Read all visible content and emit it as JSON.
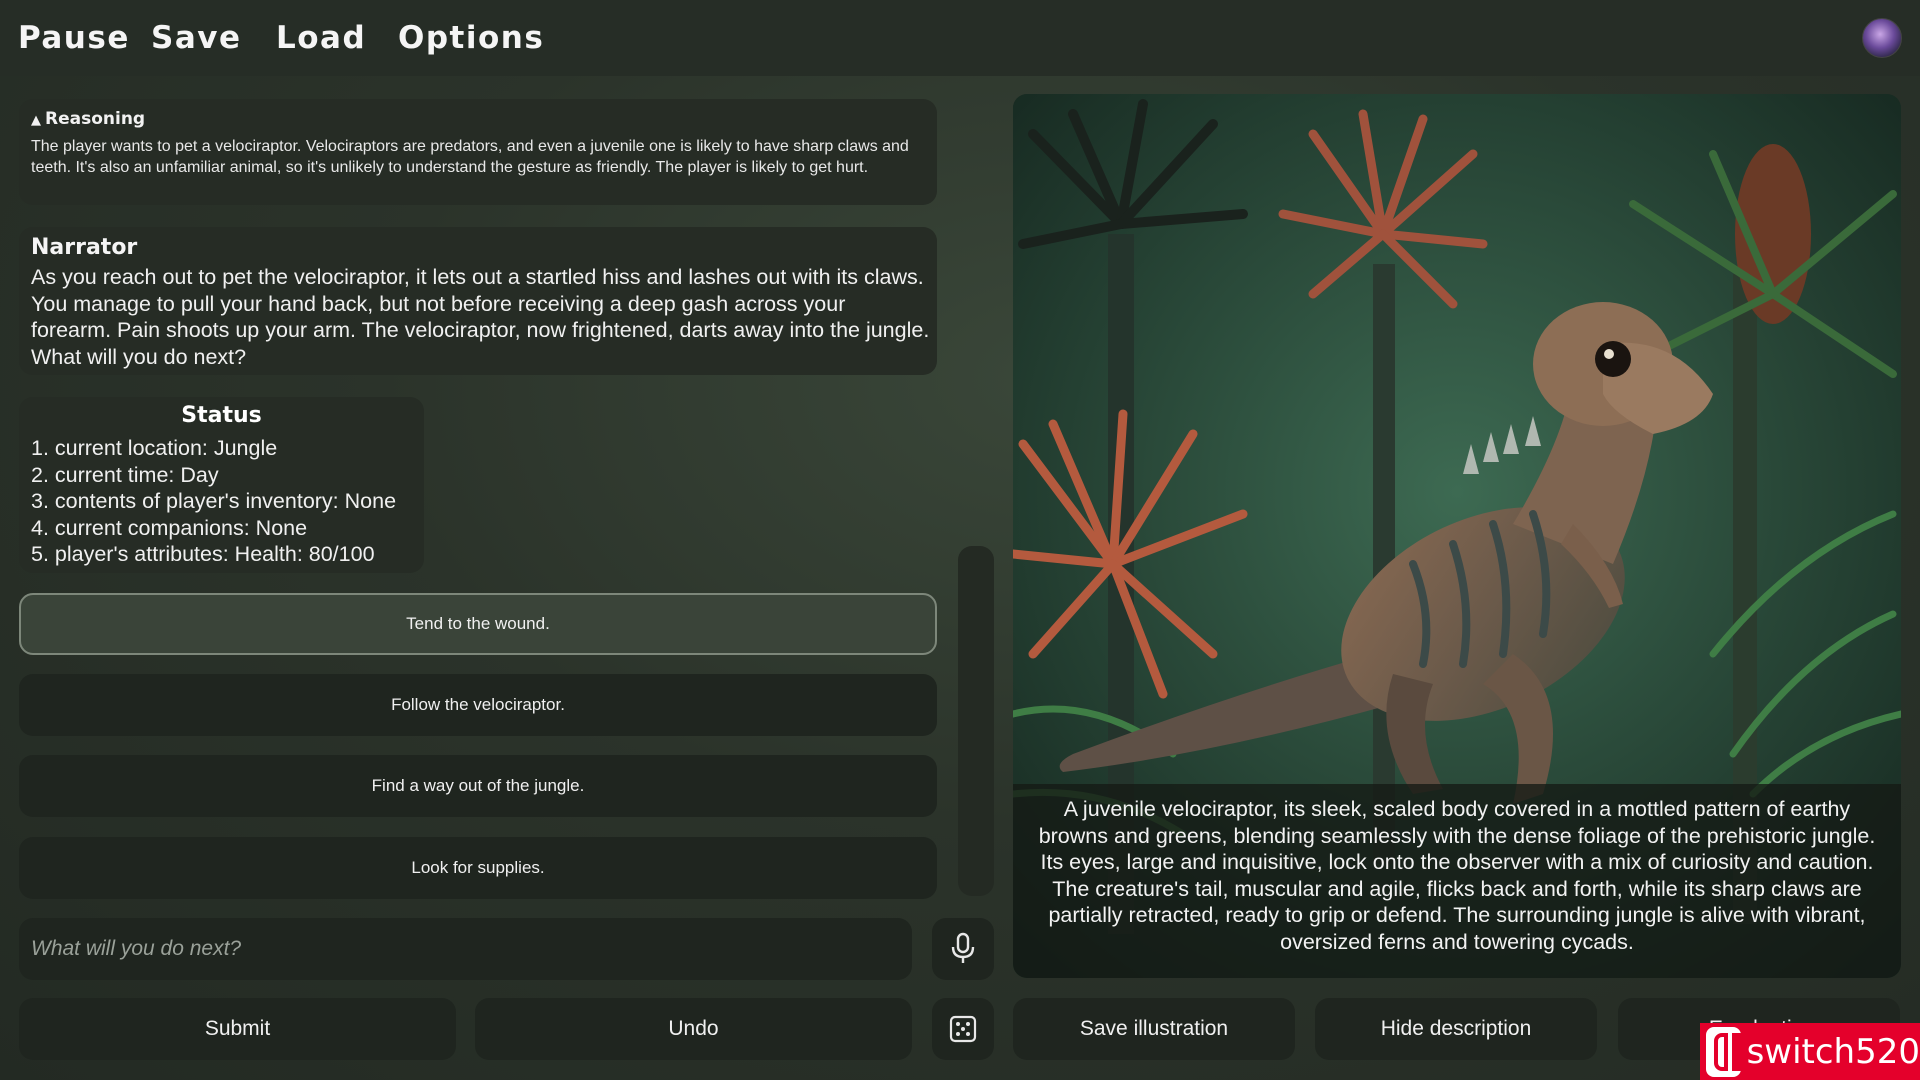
{
  "menu": {
    "pause": "Pause",
    "save": "Save",
    "load": "Load",
    "options": "Options"
  },
  "reasoning": {
    "title": "Reasoning",
    "text": "The player wants to pet a velociraptor. Velociraptors are predators, and even a juvenile one is likely to have sharp claws and teeth. It's also an unfamiliar animal, so it's unlikely to understand the gesture as friendly. The player is likely to get hurt."
  },
  "narrator": {
    "title": "Narrator",
    "text": "As you reach out to pet the velociraptor, it lets out a startled hiss and lashes out with its claws. You manage to pull your hand back, but not before receiving a deep gash across your forearm. Pain shoots up your arm. The velociraptor, now frightened, darts away into the jungle. What will you do next?"
  },
  "status": {
    "title": "Status",
    "items": [
      "1. current location: Jungle",
      "2. current time: Day",
      "3. contents of player's inventory: None",
      "4. current companions: None",
      "5. player's attributes: Health: 80/100"
    ]
  },
  "choices": [
    "Tend to the wound.",
    "Follow the velociraptor.",
    "Find a way out of the jungle.",
    "Look for supplies."
  ],
  "input": {
    "placeholder": "What will you do next?",
    "value": ""
  },
  "buttons": {
    "submit": "Submit",
    "undo": "Undo",
    "save_illustration": "Save illustration",
    "hide_description": "Hide description",
    "partial_button": "E... d... ti..."
  },
  "illustration": {
    "caption": "A juvenile velociraptor, its sleek, scaled body covered in a mottled pattern of earthy browns and greens, blending seamlessly with the dense foliage of the prehistoric jungle. Its eyes, large and inquisitive, lock onto the observer with a mix of curiosity and caution. The creature's tail, muscular and agile, flicks back and forth, while its sharp claws are partially retracted, ready to grip or defend. The surrounding jungle is alive with vibrant, oversized ferns and towering cycads."
  },
  "watermark": {
    "text": "switch520"
  },
  "icons": {
    "mic": "microphone-icon",
    "dice": "dice-icon",
    "reasoning_toggle": "triangle-up-icon",
    "avatar": "user-avatar"
  },
  "colors": {
    "background": "#2a3129",
    "panel": "#262c25",
    "button": "#1f251f",
    "selected_choice": "#3a4439",
    "watermark": "#e4002b"
  }
}
